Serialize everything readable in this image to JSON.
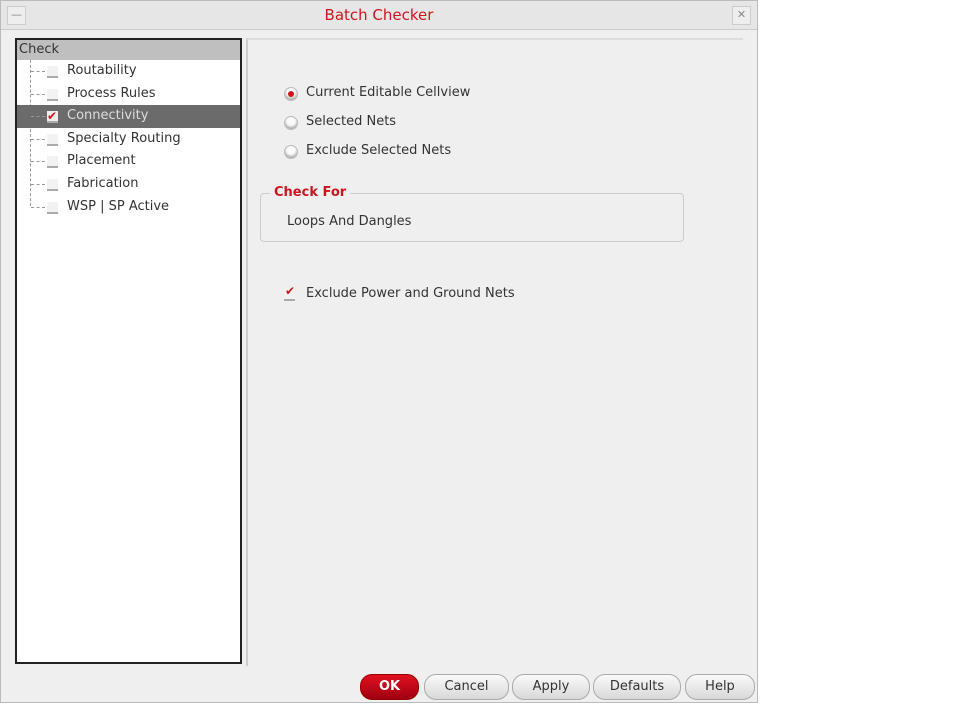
{
  "window": {
    "title": "Batch Checker"
  },
  "tree": {
    "header": "Check",
    "items": [
      {
        "label": "Routability",
        "checked": false
      },
      {
        "label": "Process Rules",
        "checked": false
      },
      {
        "label": "Connectivity",
        "checked": true,
        "selected": true
      },
      {
        "label": "Specialty Routing",
        "checked": false
      },
      {
        "label": "Placement",
        "checked": false
      },
      {
        "label": "Fabrication",
        "checked": false
      },
      {
        "label": "WSP | SP Active",
        "checked": false
      }
    ]
  },
  "scope": {
    "options": [
      "Current Editable Cellview",
      "Selected Nets",
      "Exclude Selected Nets"
    ],
    "selected": "Current Editable Cellview"
  },
  "check_for": {
    "title": "Check For",
    "value": "Loops And Dangles"
  },
  "exclude_pg": {
    "label": "Exclude Power and Ground Nets",
    "checked": true
  },
  "buttons": {
    "ok": "OK",
    "cancel": "Cancel",
    "apply": "Apply",
    "defaults": "Defaults",
    "help": "Help"
  },
  "colors": {
    "accent": "#d0141e"
  }
}
